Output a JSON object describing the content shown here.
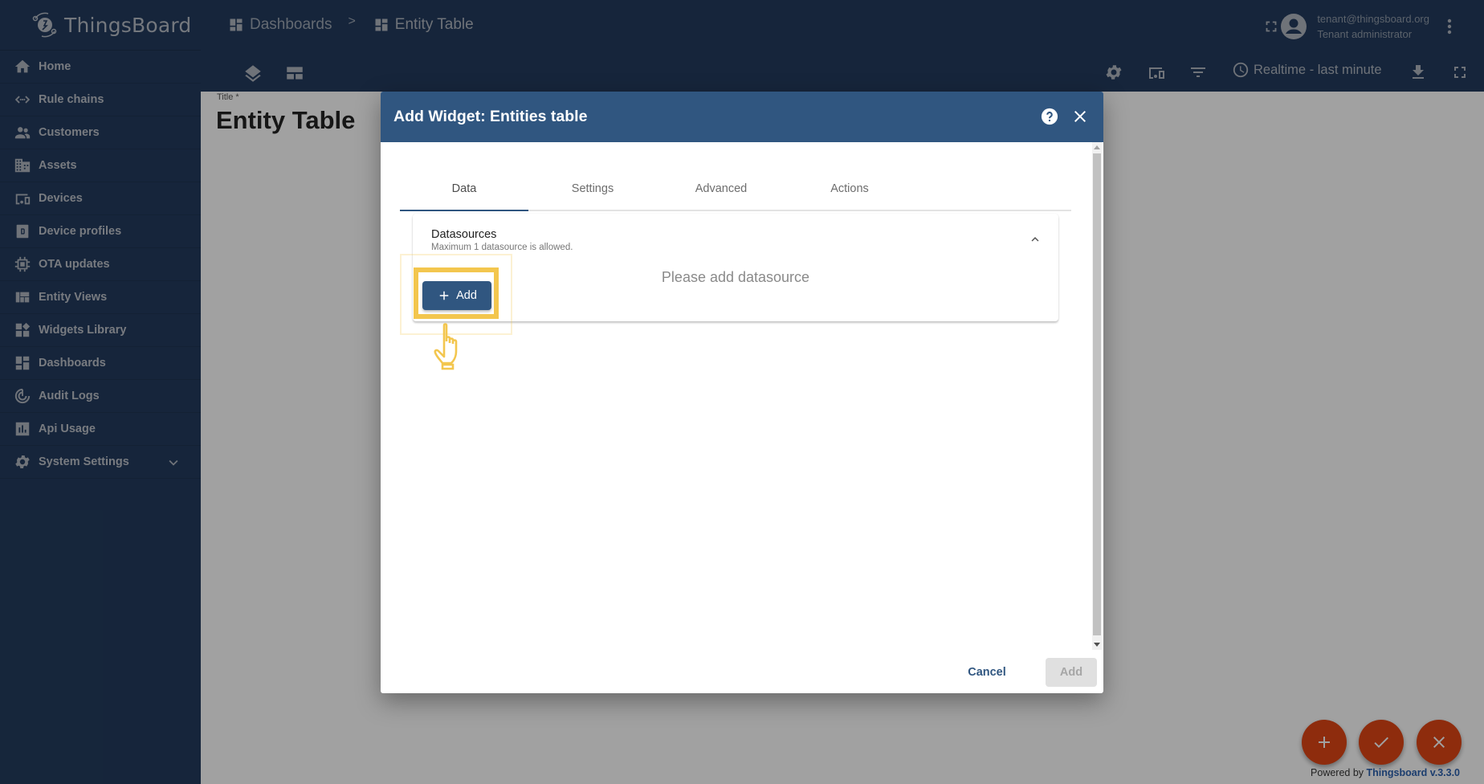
{
  "app": {
    "name": "ThingsBoard"
  },
  "sidebar": {
    "items": [
      {
        "label": "Home",
        "icon": "home-icon"
      },
      {
        "label": "Rule chains",
        "icon": "code-icon"
      },
      {
        "label": "Customers",
        "icon": "people-icon"
      },
      {
        "label": "Assets",
        "icon": "building-icon"
      },
      {
        "label": "Devices",
        "icon": "devices-icon"
      },
      {
        "label": "Device profiles",
        "icon": "device-profile-icon"
      },
      {
        "label": "OTA updates",
        "icon": "chip-icon"
      },
      {
        "label": "Entity Views",
        "icon": "view-quilt-icon"
      },
      {
        "label": "Widgets Library",
        "icon": "widgets-icon"
      },
      {
        "label": "Dashboards",
        "icon": "dashboard-icon"
      },
      {
        "label": "Audit Logs",
        "icon": "track-changes-icon"
      },
      {
        "label": "Api Usage",
        "icon": "bar-chart-icon"
      },
      {
        "label": "System Settings",
        "icon": "gear-icon",
        "expandable": true
      }
    ]
  },
  "header": {
    "breadcrumb": [
      {
        "label": "Dashboards",
        "icon": "dashboard-icon"
      },
      {
        "label": "Entity Table",
        "icon": "dashboard-icon"
      }
    ],
    "breadcrumb_separator": ">",
    "user": {
      "email": "tenant@thingsboard.org",
      "role": "Tenant administrator"
    },
    "time_window": "Realtime - last minute"
  },
  "dashboard": {
    "title_label": "Title *",
    "title_value": "Entity Table"
  },
  "dialog": {
    "title": "Add Widget: Entities table",
    "tabs": [
      {
        "label": "Data",
        "active": true
      },
      {
        "label": "Settings",
        "active": false
      },
      {
        "label": "Advanced",
        "active": false
      },
      {
        "label": "Actions",
        "active": false
      }
    ],
    "datasources": {
      "title": "Datasources",
      "subtitle": "Maximum 1 datasource is allowed.",
      "empty_message": "Please add datasource",
      "add_label": "Add"
    },
    "cancel_label": "Cancel",
    "add_label": "Add"
  },
  "fabs": [
    {
      "name": "add-widget-fab",
      "icon": "plus-icon"
    },
    {
      "name": "apply-changes-fab",
      "icon": "check-icon"
    },
    {
      "name": "discard-changes-fab",
      "icon": "close-icon"
    }
  ],
  "footer": {
    "powered_prefix": "Powered by",
    "powered_link": "Thingsboard v.3.3.0"
  },
  "colors": {
    "primary": "#305680",
    "sidebar": "#22395a",
    "fab": "#d84315",
    "highlight": "#f3c64e"
  }
}
